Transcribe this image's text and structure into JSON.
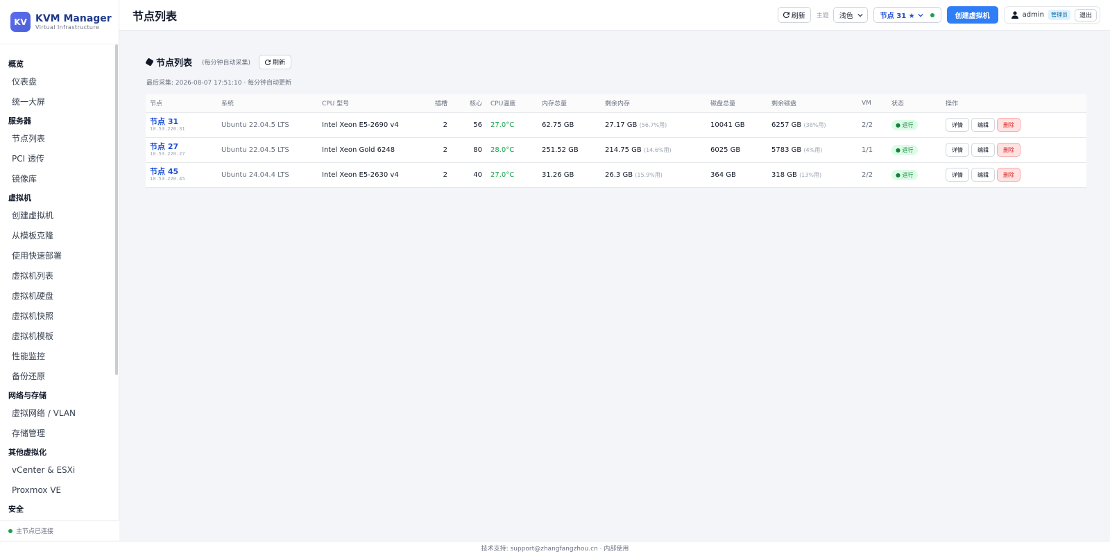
{
  "brand": {
    "logo": "KV",
    "name": "KVM Manager",
    "subtitle": "Virtual Infrastructure"
  },
  "sidebar": {
    "groups": [
      {
        "label": "概览",
        "items": [
          "仪表盘",
          "统一大屏"
        ]
      },
      {
        "label": "服务器",
        "items": [
          "节点列表",
          "PCI 透传",
          "镜像库"
        ]
      },
      {
        "label": "虚拟机",
        "items": [
          "创建虚拟机",
          "从模板克隆",
          "使用快速部署",
          "虚拟机列表",
          "虚拟机硬盘",
          "虚拟机快照",
          "虚拟机模板",
          "性能监控",
          "备份还原"
        ]
      },
      {
        "label": "网络与存储",
        "items": [
          "虚拟网络 / VLAN",
          "存储管理"
        ]
      },
      {
        "label": "其他虚拟化",
        "items": [
          "vCenter & ESXi",
          "Proxmox VE"
        ]
      },
      {
        "label": "安全",
        "items": []
      }
    ],
    "footer_status": "主节点已连接"
  },
  "topbar": {
    "title": "节点列表",
    "refresh_label": "刷新",
    "theme_label": "主题",
    "theme_value": "浅色",
    "node_select": "节点 31 ★",
    "create_vm_label": "创建虚拟机",
    "user": "admin",
    "role": "管理员",
    "logout_label": "退出"
  },
  "section": {
    "title": "节点列表",
    "note": "(每分钟自动采集)",
    "refresh_label": "刷新",
    "collect_time": "最后采集: 2026-08-07 17:51:10 · 每分钟自动更新"
  },
  "table": {
    "headers": [
      "节点",
      "系统",
      "CPU 型号",
      "插槽",
      "核心",
      "CPU温度",
      "内存总量",
      "剩余内存",
      "磁盘总量",
      "剩余磁盘",
      "VM",
      "状态",
      "操作"
    ],
    "rows": [
      {
        "name": "节点 31",
        "ip": "10.53.220.31",
        "os": "Ubuntu 22.04.5 LTS",
        "cpu": "Intel Xeon E5-2690 v4",
        "sockets": "2",
        "cores": "56",
        "temp": "27.0°C",
        "mem_total": "62.75 GB",
        "mem_free": "27.17 GB",
        "mem_pct": "(56.7%用)",
        "disk_total": "10041 GB",
        "disk_free": "6257 GB",
        "disk_pct": "(38%用)",
        "vm": "2/2",
        "status": "● 运行"
      },
      {
        "name": "节点 27",
        "ip": "10.53.220.27",
        "os": "Ubuntu 22.04.5 LTS",
        "cpu": "Intel Xeon Gold 6248",
        "sockets": "2",
        "cores": "80",
        "temp": "28.0°C",
        "mem_total": "251.52 GB",
        "mem_free": "214.75 GB",
        "mem_pct": "(14.6%用)",
        "disk_total": "6025 GB",
        "disk_free": "5783 GB",
        "disk_pct": "(4%用)",
        "vm": "1/1",
        "status": "● 运行"
      },
      {
        "name": "节点 45",
        "ip": "10.53.220.45",
        "os": "Ubuntu 24.04.4 LTS",
        "cpu": "Intel Xeon E5-2630 v4",
        "sockets": "2",
        "cores": "40",
        "temp": "27.0°C",
        "mem_total": "31.26 GB",
        "mem_free": "26.3 GB",
        "mem_pct": "(15.9%用)",
        "disk_total": "364 GB",
        "disk_free": "318 GB",
        "disk_pct": "(13%用)",
        "vm": "2/2",
        "status": "● 运行"
      }
    ],
    "actions": {
      "detail": "详情",
      "edit": "编辑",
      "delete": "删除"
    }
  },
  "footer": {
    "text": "技术支持: support@zhangfangzhou.cn · 内部使用"
  },
  "colors": {
    "primary": "#2f7ef5",
    "link": "#1d4ed8",
    "running": "#16a34a",
    "danger": "#dc2626"
  },
  "icons": [
    "refresh-icon",
    "chevron-down-icon",
    "user-icon",
    "status-dot-icon"
  ]
}
